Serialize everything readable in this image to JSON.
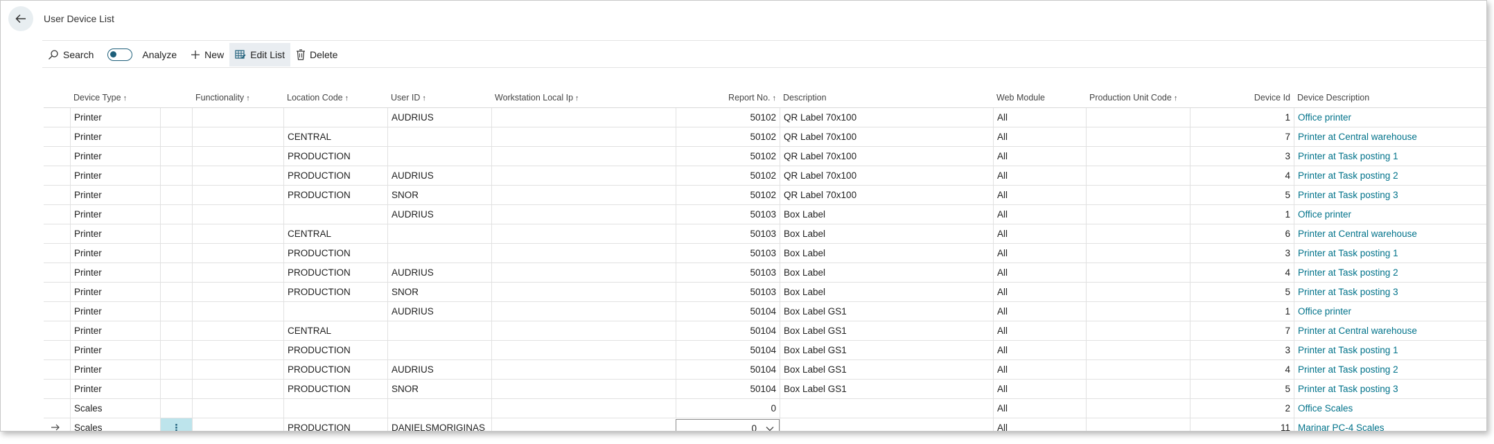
{
  "page": {
    "title": "User Device List"
  },
  "icons": {
    "back": "arrow-left-icon",
    "search": "magnifier-icon",
    "analyze": "toggle-icon",
    "new": "plus-icon",
    "edit": "grid-edit-icon",
    "delete": "trash-icon",
    "row_arrow": "arrow-right-icon",
    "dropdown": "chevron-down-icon"
  },
  "colors": {
    "link": "#00728a",
    "accent": "#1e5f7a",
    "active_action": "#e9edf1",
    "selected_cell": "#bde4ec"
  },
  "actions": {
    "search": "Search",
    "analyze": "Analyze",
    "new": "New",
    "edit_list": "Edit List",
    "delete": "Delete"
  },
  "columns": {
    "device_type": "Device Type",
    "functionality": "Functionality",
    "location_code": "Location Code",
    "user_id": "User ID",
    "workstation": "Workstation Local Ip",
    "report_no": "Report No.",
    "description": "Description",
    "web_module": "Web Module",
    "production_unit": "Production Unit Code",
    "device_id": "Device Id",
    "device_description": "Device Description",
    "sort_indicator": "↑"
  },
  "rows": [
    {
      "type": "Printer",
      "functionality": "",
      "location": "",
      "user": "AUDRIUS",
      "ip": "",
      "report": "50102",
      "description": "QR Label 70x100",
      "web": "All",
      "unit": "",
      "id": "1",
      "device": "Office printer"
    },
    {
      "type": "Printer",
      "functionality": "",
      "location": "CENTRAL",
      "user": "",
      "ip": "",
      "report": "50102",
      "description": "QR Label 70x100",
      "web": "All",
      "unit": "",
      "id": "7",
      "device": "Printer at Central warehouse"
    },
    {
      "type": "Printer",
      "functionality": "",
      "location": "PRODUCTION",
      "user": "",
      "ip": "",
      "report": "50102",
      "description": "QR Label 70x100",
      "web": "All",
      "unit": "",
      "id": "3",
      "device": "Printer at Task posting 1"
    },
    {
      "type": "Printer",
      "functionality": "",
      "location": "PRODUCTION",
      "user": "AUDRIUS",
      "ip": "",
      "report": "50102",
      "description": "QR Label 70x100",
      "web": "All",
      "unit": "",
      "id": "4",
      "device": "Printer at Task posting 2"
    },
    {
      "type": "Printer",
      "functionality": "",
      "location": "PRODUCTION",
      "user": "SNOR",
      "ip": "",
      "report": "50102",
      "description": "QR Label 70x100",
      "web": "All",
      "unit": "",
      "id": "5",
      "device": "Printer at Task posting 3"
    },
    {
      "type": "Printer",
      "functionality": "",
      "location": "",
      "user": "AUDRIUS",
      "ip": "",
      "report": "50103",
      "description": "Box Label",
      "web": "All",
      "unit": "",
      "id": "1",
      "device": "Office printer"
    },
    {
      "type": "Printer",
      "functionality": "",
      "location": "CENTRAL",
      "user": "",
      "ip": "",
      "report": "50103",
      "description": "Box Label",
      "web": "All",
      "unit": "",
      "id": "6",
      "device": "Printer at Central warehouse"
    },
    {
      "type": "Printer",
      "functionality": "",
      "location": "PRODUCTION",
      "user": "",
      "ip": "",
      "report": "50103",
      "description": "Box Label",
      "web": "All",
      "unit": "",
      "id": "3",
      "device": "Printer at Task posting 1"
    },
    {
      "type": "Printer",
      "functionality": "",
      "location": "PRODUCTION",
      "user": "AUDRIUS",
      "ip": "",
      "report": "50103",
      "description": "Box Label",
      "web": "All",
      "unit": "",
      "id": "4",
      "device": "Printer at Task posting 2"
    },
    {
      "type": "Printer",
      "functionality": "",
      "location": "PRODUCTION",
      "user": "SNOR",
      "ip": "",
      "report": "50103",
      "description": "Box Label",
      "web": "All",
      "unit": "",
      "id": "5",
      "device": "Printer at Task posting 3"
    },
    {
      "type": "Printer",
      "functionality": "",
      "location": "",
      "user": "AUDRIUS",
      "ip": "",
      "report": "50104",
      "description": "Box Label GS1",
      "web": "All",
      "unit": "",
      "id": "1",
      "device": "Office printer"
    },
    {
      "type": "Printer",
      "functionality": "",
      "location": "CENTRAL",
      "user": "",
      "ip": "",
      "report": "50104",
      "description": "Box Label GS1",
      "web": "All",
      "unit": "",
      "id": "7",
      "device": "Printer at Central warehouse"
    },
    {
      "type": "Printer",
      "functionality": "",
      "location": "PRODUCTION",
      "user": "",
      "ip": "",
      "report": "50104",
      "description": "Box Label GS1",
      "web": "All",
      "unit": "",
      "id": "3",
      "device": "Printer at Task posting 1"
    },
    {
      "type": "Printer",
      "functionality": "",
      "location": "PRODUCTION",
      "user": "AUDRIUS",
      "ip": "",
      "report": "50104",
      "description": "Box Label GS1",
      "web": "All",
      "unit": "",
      "id": "4",
      "device": "Printer at Task posting 2"
    },
    {
      "type": "Printer",
      "functionality": "",
      "location": "PRODUCTION",
      "user": "SNOR",
      "ip": "",
      "report": "50104",
      "description": "Box Label GS1",
      "web": "All",
      "unit": "",
      "id": "5",
      "device": "Printer at Task posting 3"
    },
    {
      "type": "Scales",
      "functionality": "",
      "location": "",
      "user": "",
      "ip": "",
      "report": "0",
      "description": "",
      "web": "All",
      "unit": "",
      "id": "2",
      "device": "Office Scales"
    },
    {
      "type": "Scales",
      "functionality": "",
      "location": "PRODUCTION",
      "user": "DANIELSMORIGINAS",
      "ip": "",
      "report": "0",
      "description": "",
      "web": "All",
      "unit": "",
      "id": "11",
      "device": "Marinar PC-4 Scales",
      "selected": true,
      "row_menu": "⋮"
    }
  ]
}
